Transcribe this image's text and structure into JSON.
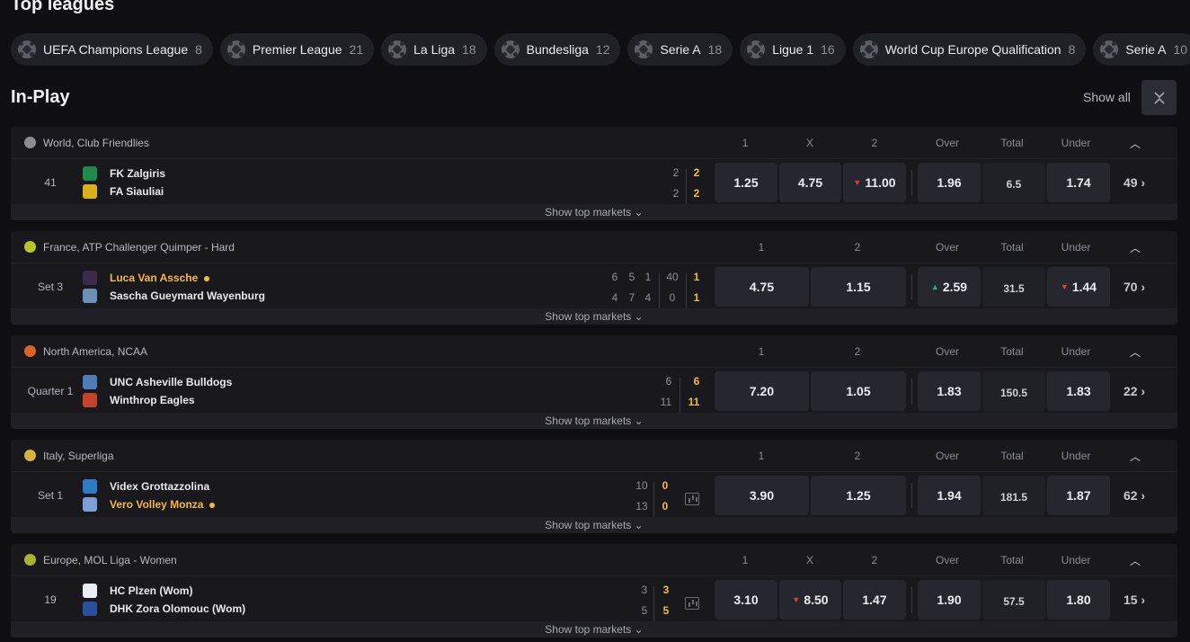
{
  "top_leagues": {
    "title": "Top leagues",
    "chips": [
      {
        "name": "UEFA Champions League",
        "count": "8"
      },
      {
        "name": "Premier League",
        "count": "21"
      },
      {
        "name": "La Liga",
        "count": "18"
      },
      {
        "name": "Bundesliga",
        "count": "12"
      },
      {
        "name": "Serie A",
        "count": "18"
      },
      {
        "name": "Ligue 1",
        "count": "16"
      },
      {
        "name": "World Cup Europe Qualification",
        "count": "8"
      },
      {
        "name": "Serie A",
        "count": "10"
      }
    ]
  },
  "inplay": {
    "title": "In-Play",
    "show_all": "Show all",
    "collapse_icon": "double-chevron-icon"
  },
  "labels": {
    "show_top_markets": "Show top markets",
    "over": "Over",
    "total": "Total",
    "under": "Under"
  },
  "colors": {
    "accent": "#f5b942",
    "odd_down": "#e0403f",
    "odd_up": "#2fb46d"
  },
  "events": [
    {
      "league": "World, Club Friendlies",
      "sport_icon": "soccer-ball-icon",
      "headers": [
        "1",
        "X",
        "2"
      ],
      "period": "41",
      "home": {
        "name": "FK Zalgiris"
      },
      "away": {
        "name": "FA Siauliai"
      },
      "odds": [
        "1.25",
        "4.75",
        "11.00"
      ],
      "over": "1.96",
      "total": "6.5",
      "under": "1.74",
      "more": "49",
      "scores_home": [
        "2",
        "2"
      ],
      "scores_away": [
        "2",
        "2"
      ]
    },
    {
      "league": "France, ATP Challenger Quimper - Hard",
      "sport_icon": "tennis-ball-icon",
      "headers": [
        "1",
        "2"
      ],
      "period": "Set 3",
      "home": {
        "name": "Luca Van Assche"
      },
      "away": {
        "name": "Sascha Gueymard Wayenburg"
      },
      "odds": [
        "4.75",
        "1.15"
      ],
      "over": "2.59",
      "total": "31.5",
      "under": "1.44",
      "more": "70",
      "scores_home": [
        "6",
        "5",
        "1",
        "40",
        "1"
      ],
      "scores_away": [
        "4",
        "7",
        "4",
        "0",
        "1"
      ]
    },
    {
      "league": "North America, NCAA",
      "sport_icon": "basketball-icon",
      "headers": [
        "1",
        "2"
      ],
      "period": "Quarter 1",
      "home": {
        "name": "UNC Asheville Bulldogs"
      },
      "away": {
        "name": "Winthrop Eagles"
      },
      "odds": [
        "7.20",
        "1.05"
      ],
      "over": "1.83",
      "total": "150.5",
      "under": "1.83",
      "more": "22",
      "scores_home": [
        "6",
        "6"
      ],
      "scores_away": [
        "11",
        "11"
      ]
    },
    {
      "league": "Italy, Superliga",
      "sport_icon": "volleyball-icon",
      "headers": [
        "1",
        "2"
      ],
      "period": "Set 1",
      "home": {
        "name": "Videx Grottazzolina"
      },
      "away": {
        "name": "Vero Volley Monza"
      },
      "odds": [
        "3.90",
        "1.25"
      ],
      "over": "1.94",
      "total": "181.5",
      "under": "1.87",
      "more": "62",
      "scores_home": [
        "10",
        "0"
      ],
      "scores_away": [
        "13",
        "0"
      ]
    },
    {
      "league": "Europe, MOL Liga - Women",
      "sport_icon": "handball-icon",
      "headers": [
        "1",
        "X",
        "2"
      ],
      "period": "19",
      "home": {
        "name": "HC Plzen (Wom)"
      },
      "away": {
        "name": "DHK Zora Olomouc (Wom)"
      },
      "odds": [
        "3.10",
        "8.50",
        "1.47"
      ],
      "over": "1.90",
      "total": "57.5",
      "under": "1.80",
      "more": "15",
      "scores_home": [
        "3",
        "3"
      ],
      "scores_away": [
        "5",
        "5"
      ]
    }
  ]
}
